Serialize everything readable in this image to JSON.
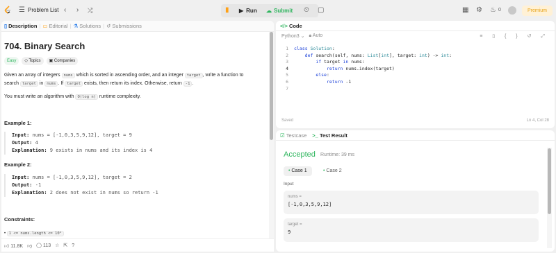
{
  "topbar": {
    "problem_list": "Problem List",
    "run": "Run",
    "submit": "Submit",
    "streak": "0",
    "premium": "Premium"
  },
  "left": {
    "tabs": [
      "Description",
      "Editorial",
      "Solutions",
      "Submissions"
    ],
    "title": "704. Binary Search",
    "tags": [
      "Easy",
      "Topics",
      "Companies"
    ],
    "desc1_a": "Given an array of integers ",
    "desc1_c1": "nums",
    "desc1_b": " which is sorted in ascending order, and an integer ",
    "desc1_c2": "target",
    "desc1_d": ", write a function to",
    "desc2_a": "search ",
    "desc2_c1": "target",
    "desc2_b": " in ",
    "desc2_c2": "nums",
    "desc2_c": ". If ",
    "desc2_c3": "target",
    "desc2_d": " exists, then return its index. Otherwise, return ",
    "desc2_c4": "-1",
    "desc2_e": ".",
    "desc3_a": "You must write an algorithm with ",
    "desc3_c": "O(log n)",
    "desc3_b": " runtime complexity.",
    "ex1_title": "Example 1:",
    "ex1_input": "nums = [-1,0,3,5,9,12], target = 9",
    "ex1_output": "4",
    "ex1_expl": "9 exists in nums and its index is 4",
    "ex2_title": "Example 2:",
    "ex2_input": "nums = [-1,0,3,5,9,12], target = 2",
    "ex2_output": "-1",
    "ex2_expl": "2 does not exist in nums so return -1",
    "input_label": "Input:",
    "output_label": "Output:",
    "expl_label": "Explanation:",
    "constraints_title": "Constraints:",
    "constraint1": "1 <= nums.length <= 10⁴",
    "likes": "11.8K",
    "comments": "113"
  },
  "code": {
    "header": "Code",
    "language": "Python3",
    "auto": "Auto",
    "lines": [
      {
        "n": "1",
        "t": "class Solution:"
      },
      {
        "n": "2",
        "t": "    def search(self, nums: List[int], target: int) -> int:"
      },
      {
        "n": "3",
        "t": "        if target in nums:"
      },
      {
        "n": "4",
        "t": "            return nums.index(target)"
      },
      {
        "n": "5",
        "t": "        else:"
      },
      {
        "n": "6",
        "t": "            return -1"
      },
      {
        "n": "7",
        "t": ""
      }
    ],
    "saved": "Saved",
    "position": "Ln 4, Col 28"
  },
  "result": {
    "tab_testcase": "Testcase",
    "tab_result": "Test Result",
    "status": "Accepted",
    "runtime": "Runtime: 39 ms",
    "cases": [
      "Case 1",
      "Case 2"
    ],
    "input_label": "Input",
    "nums_key": "nums =",
    "nums_val": "[-1,0,3,5,9,12]",
    "target_key": "target =",
    "target_val": "9"
  }
}
